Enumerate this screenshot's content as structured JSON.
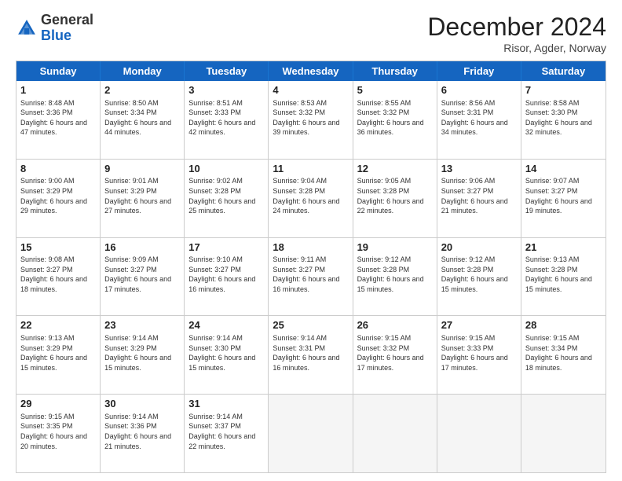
{
  "header": {
    "logo_general": "General",
    "logo_blue": "Blue",
    "month_title": "December 2024",
    "location": "Risor, Agder, Norway"
  },
  "days_of_week": [
    "Sunday",
    "Monday",
    "Tuesday",
    "Wednesday",
    "Thursday",
    "Friday",
    "Saturday"
  ],
  "weeks": [
    [
      {
        "day": "1",
        "sunrise": "Sunrise: 8:48 AM",
        "sunset": "Sunset: 3:36 PM",
        "daylight": "Daylight: 6 hours and 47 minutes."
      },
      {
        "day": "2",
        "sunrise": "Sunrise: 8:50 AM",
        "sunset": "Sunset: 3:34 PM",
        "daylight": "Daylight: 6 hours and 44 minutes."
      },
      {
        "day": "3",
        "sunrise": "Sunrise: 8:51 AM",
        "sunset": "Sunset: 3:33 PM",
        "daylight": "Daylight: 6 hours and 42 minutes."
      },
      {
        "day": "4",
        "sunrise": "Sunrise: 8:53 AM",
        "sunset": "Sunset: 3:32 PM",
        "daylight": "Daylight: 6 hours and 39 minutes."
      },
      {
        "day": "5",
        "sunrise": "Sunrise: 8:55 AM",
        "sunset": "Sunset: 3:32 PM",
        "daylight": "Daylight: 6 hours and 36 minutes."
      },
      {
        "day": "6",
        "sunrise": "Sunrise: 8:56 AM",
        "sunset": "Sunset: 3:31 PM",
        "daylight": "Daylight: 6 hours and 34 minutes."
      },
      {
        "day": "7",
        "sunrise": "Sunrise: 8:58 AM",
        "sunset": "Sunset: 3:30 PM",
        "daylight": "Daylight: 6 hours and 32 minutes."
      }
    ],
    [
      {
        "day": "8",
        "sunrise": "Sunrise: 9:00 AM",
        "sunset": "Sunset: 3:29 PM",
        "daylight": "Daylight: 6 hours and 29 minutes."
      },
      {
        "day": "9",
        "sunrise": "Sunrise: 9:01 AM",
        "sunset": "Sunset: 3:29 PM",
        "daylight": "Daylight: 6 hours and 27 minutes."
      },
      {
        "day": "10",
        "sunrise": "Sunrise: 9:02 AM",
        "sunset": "Sunset: 3:28 PM",
        "daylight": "Daylight: 6 hours and 25 minutes."
      },
      {
        "day": "11",
        "sunrise": "Sunrise: 9:04 AM",
        "sunset": "Sunset: 3:28 PM",
        "daylight": "Daylight: 6 hours and 24 minutes."
      },
      {
        "day": "12",
        "sunrise": "Sunrise: 9:05 AM",
        "sunset": "Sunset: 3:28 PM",
        "daylight": "Daylight: 6 hours and 22 minutes."
      },
      {
        "day": "13",
        "sunrise": "Sunrise: 9:06 AM",
        "sunset": "Sunset: 3:27 PM",
        "daylight": "Daylight: 6 hours and 21 minutes."
      },
      {
        "day": "14",
        "sunrise": "Sunrise: 9:07 AM",
        "sunset": "Sunset: 3:27 PM",
        "daylight": "Daylight: 6 hours and 19 minutes."
      }
    ],
    [
      {
        "day": "15",
        "sunrise": "Sunrise: 9:08 AM",
        "sunset": "Sunset: 3:27 PM",
        "daylight": "Daylight: 6 hours and 18 minutes."
      },
      {
        "day": "16",
        "sunrise": "Sunrise: 9:09 AM",
        "sunset": "Sunset: 3:27 PM",
        "daylight": "Daylight: 6 hours and 17 minutes."
      },
      {
        "day": "17",
        "sunrise": "Sunrise: 9:10 AM",
        "sunset": "Sunset: 3:27 PM",
        "daylight": "Daylight: 6 hours and 16 minutes."
      },
      {
        "day": "18",
        "sunrise": "Sunrise: 9:11 AM",
        "sunset": "Sunset: 3:27 PM",
        "daylight": "Daylight: 6 hours and 16 minutes."
      },
      {
        "day": "19",
        "sunrise": "Sunrise: 9:12 AM",
        "sunset": "Sunset: 3:28 PM",
        "daylight": "Daylight: 6 hours and 15 minutes."
      },
      {
        "day": "20",
        "sunrise": "Sunrise: 9:12 AM",
        "sunset": "Sunset: 3:28 PM",
        "daylight": "Daylight: 6 hours and 15 minutes."
      },
      {
        "day": "21",
        "sunrise": "Sunrise: 9:13 AM",
        "sunset": "Sunset: 3:28 PM",
        "daylight": "Daylight: 6 hours and 15 minutes."
      }
    ],
    [
      {
        "day": "22",
        "sunrise": "Sunrise: 9:13 AM",
        "sunset": "Sunset: 3:29 PM",
        "daylight": "Daylight: 6 hours and 15 minutes."
      },
      {
        "day": "23",
        "sunrise": "Sunrise: 9:14 AM",
        "sunset": "Sunset: 3:29 PM",
        "daylight": "Daylight: 6 hours and 15 minutes."
      },
      {
        "day": "24",
        "sunrise": "Sunrise: 9:14 AM",
        "sunset": "Sunset: 3:30 PM",
        "daylight": "Daylight: 6 hours and 15 minutes."
      },
      {
        "day": "25",
        "sunrise": "Sunrise: 9:14 AM",
        "sunset": "Sunset: 3:31 PM",
        "daylight": "Daylight: 6 hours and 16 minutes."
      },
      {
        "day": "26",
        "sunrise": "Sunrise: 9:15 AM",
        "sunset": "Sunset: 3:32 PM",
        "daylight": "Daylight: 6 hours and 17 minutes."
      },
      {
        "day": "27",
        "sunrise": "Sunrise: 9:15 AM",
        "sunset": "Sunset: 3:33 PM",
        "daylight": "Daylight: 6 hours and 17 minutes."
      },
      {
        "day": "28",
        "sunrise": "Sunrise: 9:15 AM",
        "sunset": "Sunset: 3:34 PM",
        "daylight": "Daylight: 6 hours and 18 minutes."
      }
    ],
    [
      {
        "day": "29",
        "sunrise": "Sunrise: 9:15 AM",
        "sunset": "Sunset: 3:35 PM",
        "daylight": "Daylight: 6 hours and 20 minutes."
      },
      {
        "day": "30",
        "sunrise": "Sunrise: 9:14 AM",
        "sunset": "Sunset: 3:36 PM",
        "daylight": "Daylight: 6 hours and 21 minutes."
      },
      {
        "day": "31",
        "sunrise": "Sunrise: 9:14 AM",
        "sunset": "Sunset: 3:37 PM",
        "daylight": "Daylight: 6 hours and 22 minutes."
      },
      {
        "day": "",
        "sunrise": "",
        "sunset": "",
        "daylight": ""
      },
      {
        "day": "",
        "sunrise": "",
        "sunset": "",
        "daylight": ""
      },
      {
        "day": "",
        "sunrise": "",
        "sunset": "",
        "daylight": ""
      },
      {
        "day": "",
        "sunrise": "",
        "sunset": "",
        "daylight": ""
      }
    ]
  ]
}
